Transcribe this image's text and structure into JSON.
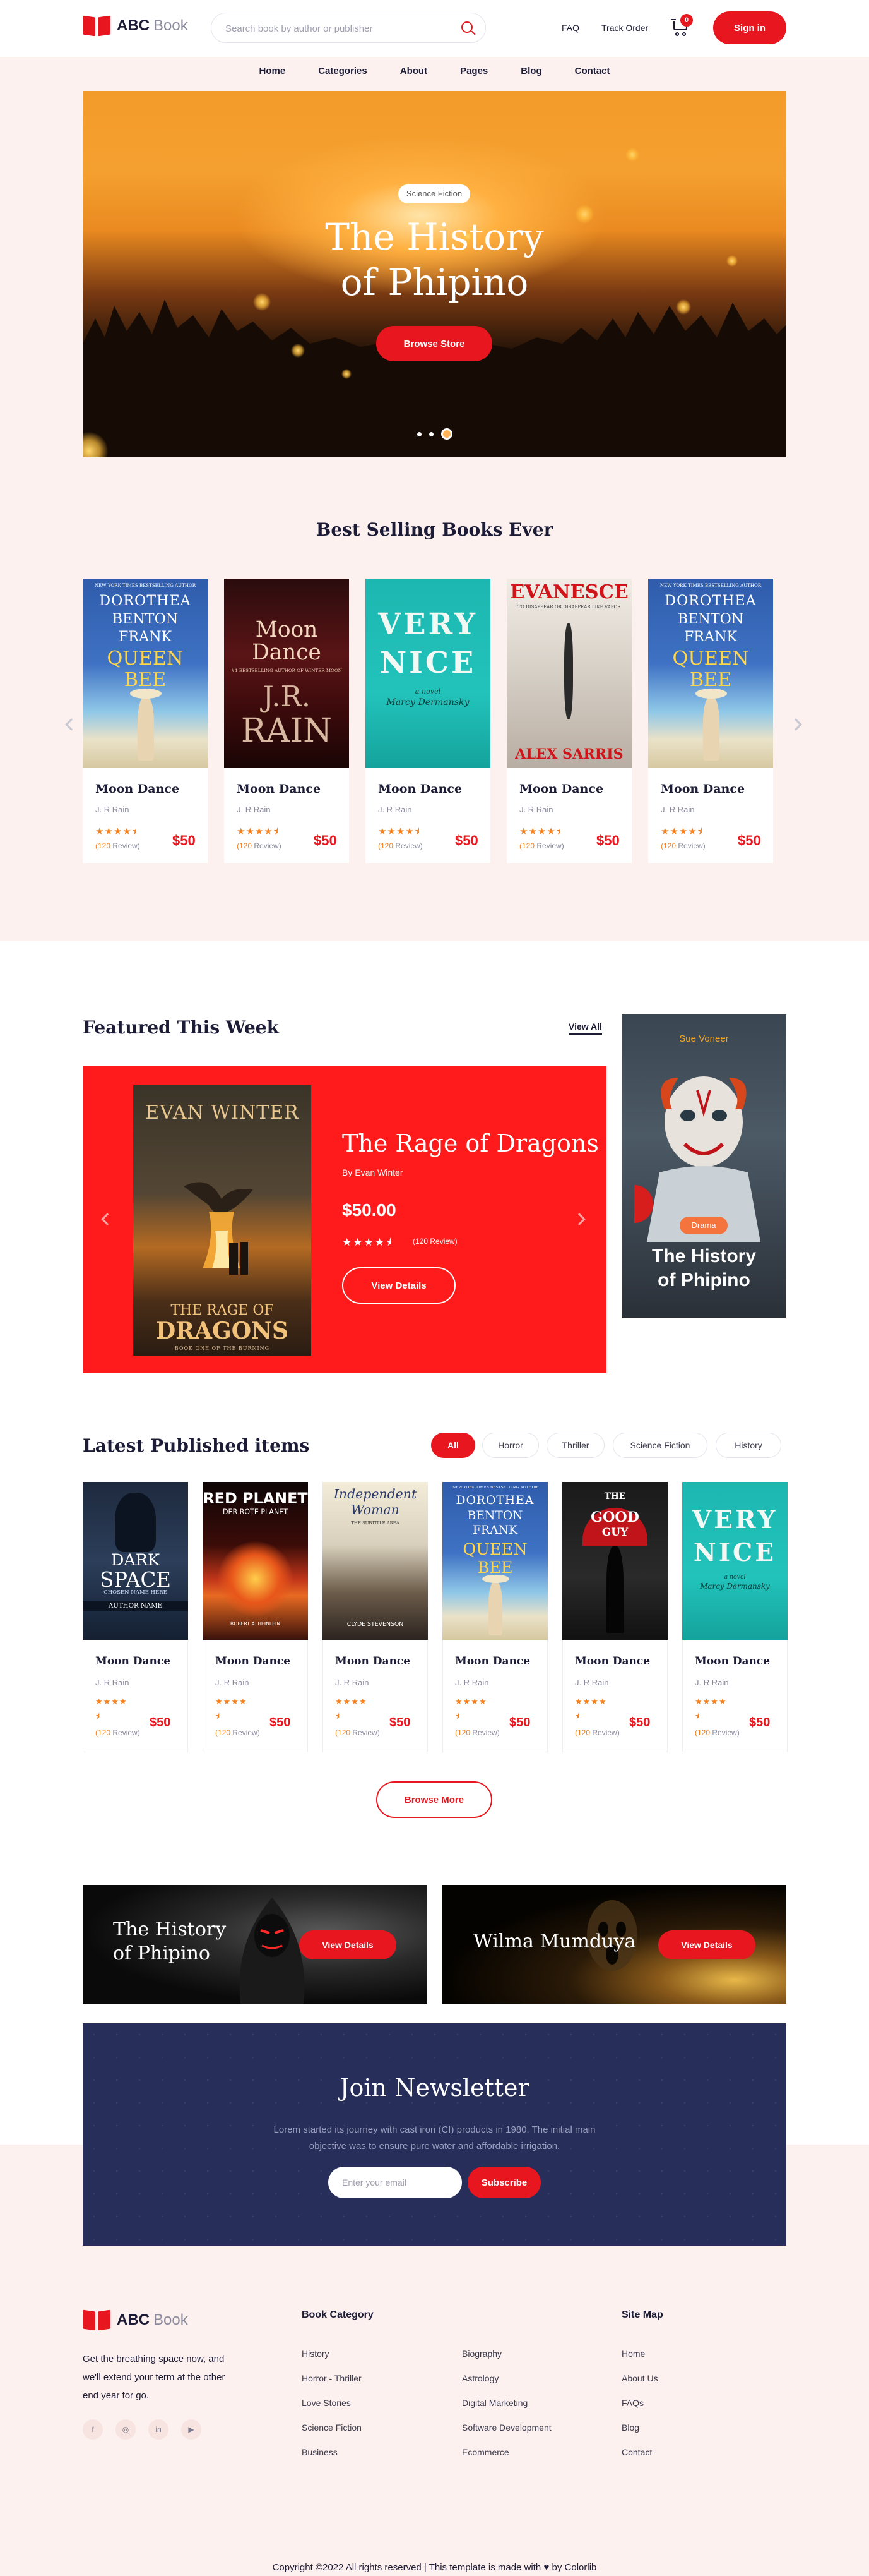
{
  "header": {
    "logo_bold": "ABC",
    "logo_light": "Book",
    "search_placeholder": "Search book by author or publisher",
    "faq": "FAQ",
    "track_order": "Track Order",
    "cart_count": "0",
    "sign_in": "Sign in"
  },
  "nav": [
    "Home",
    "Categories",
    "About",
    "Pages",
    "Blog",
    "Contact"
  ],
  "hero": {
    "tag": "Science Fiction",
    "title_line1": "The History",
    "title_line2": "of Phipino",
    "cta": "Browse Store",
    "slides": 3,
    "active_slide": 3
  },
  "best_selling": {
    "title": "Best Selling Books Ever",
    "books": [
      {
        "cover": "queen",
        "name": "Moon Dance",
        "author": "J. R Rain",
        "stars": "★★★★⯨",
        "reviews": "120",
        "price": "$50"
      },
      {
        "cover": "moon",
        "name": "Moon Dance",
        "author": "J. R Rain",
        "stars": "★★★★⯨",
        "reviews": "120",
        "price": "$50"
      },
      {
        "cover": "nice",
        "name": "Moon Dance",
        "author": "J. R Rain",
        "stars": "★★★★⯨",
        "reviews": "120",
        "price": "$50"
      },
      {
        "cover": "evan",
        "name": "Moon Dance",
        "author": "J. R Rain",
        "stars": "★★★★⯨",
        "reviews": "120",
        "price": "$50"
      },
      {
        "cover": "queen",
        "name": "Moon Dance",
        "author": "J. R Rain",
        "stars": "★★★★⯨",
        "reviews": "120",
        "price": "$50"
      }
    ],
    "review_word": "Review"
  },
  "covers": {
    "queen": {
      "l1": "NEW YORK TIMES BESTSELLING AUTHOR",
      "l2": "DOROTHEA",
      "l3": "BENTON",
      "l4": "FRANK",
      "l5": "QUEEN",
      "l6": "BEE"
    },
    "moon": {
      "l1": "Moon",
      "l2": "Dance",
      "l3": "#1 BESTSELLING AUTHOR OF WINTER MOON",
      "l4": "J.R.",
      "l5": "RAIN"
    },
    "nice": {
      "l1": "VERY",
      "l2": "NICE",
      "l3": "a novel",
      "l4": "Marcy Dermansky"
    },
    "evan": {
      "l1": "EVANESCE",
      "l2": "TO DISAPPEAR OR DISAPPEAR LIKE VAPOR",
      "l3": "ALEX SARRIS"
    },
    "dark": {
      "l1": "DARK",
      "l2": "SPACE",
      "l3": "CHOSEN NAME HERE",
      "l4": "AUTHOR NAME"
    },
    "red": {
      "l1": "RED PLANET",
      "l2": "DER ROTE PLANET",
      "l3": "ROBERT A. HEINLEIN"
    },
    "indep": {
      "l1": "Independent",
      "l2": "Woman",
      "l3": "THE SUBTITLE AREA",
      "l4": "CLYDE STEVENSON"
    },
    "good": {
      "l1": "THE",
      "l2": "GOOD",
      "l3": "GUY"
    }
  },
  "featured": {
    "title": "Featured This Week",
    "view_all": "View All",
    "cover_author": "EVAN WINTER",
    "cover_title1": "THE RAGE OF",
    "cover_title2": "DRAGONS",
    "cover_sub": "BOOK ONE OF THE BURNING",
    "book_title": "The Rage of Dragons",
    "author": "By Evan Winter",
    "price": "$50.00",
    "stars": "★★★★⯨",
    "reviews": "(120 Review)",
    "button": "View Details"
  },
  "side_ad": {
    "author": "Sue Voneer",
    "tag": "Drama",
    "title1": "The History",
    "title2": "of Phipino"
  },
  "latest": {
    "title": "Latest Published items",
    "filters": [
      "All",
      "Horror",
      "Thriller",
      "Science Fiction",
      "History"
    ],
    "active_filter": "All",
    "books": [
      {
        "cover": "dark",
        "name": "Moon Dance",
        "author": "J. R Rain",
        "stars": "★★★★",
        "half": "⯨",
        "reviews": "120",
        "price": "$50"
      },
      {
        "cover": "red",
        "name": "Moon Dance",
        "author": "J. R Rain",
        "stars": "★★★★",
        "half": "⯨",
        "reviews": "120",
        "price": "$50"
      },
      {
        "cover": "indep",
        "name": "Moon Dance",
        "author": "J. R Rain",
        "stars": "★★★★",
        "half": "⯨",
        "reviews": "120",
        "price": "$50"
      },
      {
        "cover": "queen",
        "name": "Moon Dance",
        "author": "J. R Rain",
        "stars": "★★★★",
        "half": "⯨",
        "reviews": "120",
        "price": "$50"
      },
      {
        "cover": "good",
        "name": "Moon Dance",
        "author": "J. R Rain",
        "stars": "★★★★",
        "half": "⯨",
        "reviews": "120",
        "price": "$50"
      },
      {
        "cover": "nice",
        "name": "Moon Dance",
        "author": "J. R Rain",
        "stars": "★★★★",
        "half": "⯨",
        "reviews": "120",
        "price": "$50"
      }
    ],
    "browse_more": "Browse More"
  },
  "promos": [
    {
      "title1": "The History",
      "title2": "of Phipino",
      "button": "View Details"
    },
    {
      "title1": "Wilma Mumduya",
      "title2": "",
      "button": "View Details"
    }
  ],
  "newsletter": {
    "title": "Join Newsletter",
    "text": "Lorem started its journey with cast iron (CI) products in 1980. The initial main objective was to ensure pure water and affordable irrigation.",
    "email_placeholder": "Enter your email",
    "button": "Subscribe"
  },
  "footer": {
    "about": "Get the breathing space now, and we'll extend your term at the other end year for go.",
    "social": [
      "facebook-icon",
      "instagram-icon",
      "linkedin-icon",
      "youtube-icon"
    ],
    "social_glyphs": [
      "f",
      "◎",
      "in",
      "▶"
    ],
    "book_category_title": "Book Category",
    "col1": [
      "History",
      "Horror - Thriller",
      "Love Stories",
      "Science Fiction",
      "Business"
    ],
    "col2": [
      "Biography",
      "Astrology",
      "Digital Marketing",
      "Software Development",
      "Ecommerce"
    ],
    "site_map_title": "Site Map",
    "site_map": [
      "Home",
      "About Us",
      "FAQs",
      "Blog",
      "Contact"
    ],
    "copyright_pre": "Copyright ©2022 All rights reserved | This template is made with",
    "copyright_post": "by Colorlib"
  },
  "colors": {
    "accent": "#e8171f",
    "navy": "#272e59",
    "pink_bg": "#fdf1ef",
    "star": "#f5821f"
  }
}
